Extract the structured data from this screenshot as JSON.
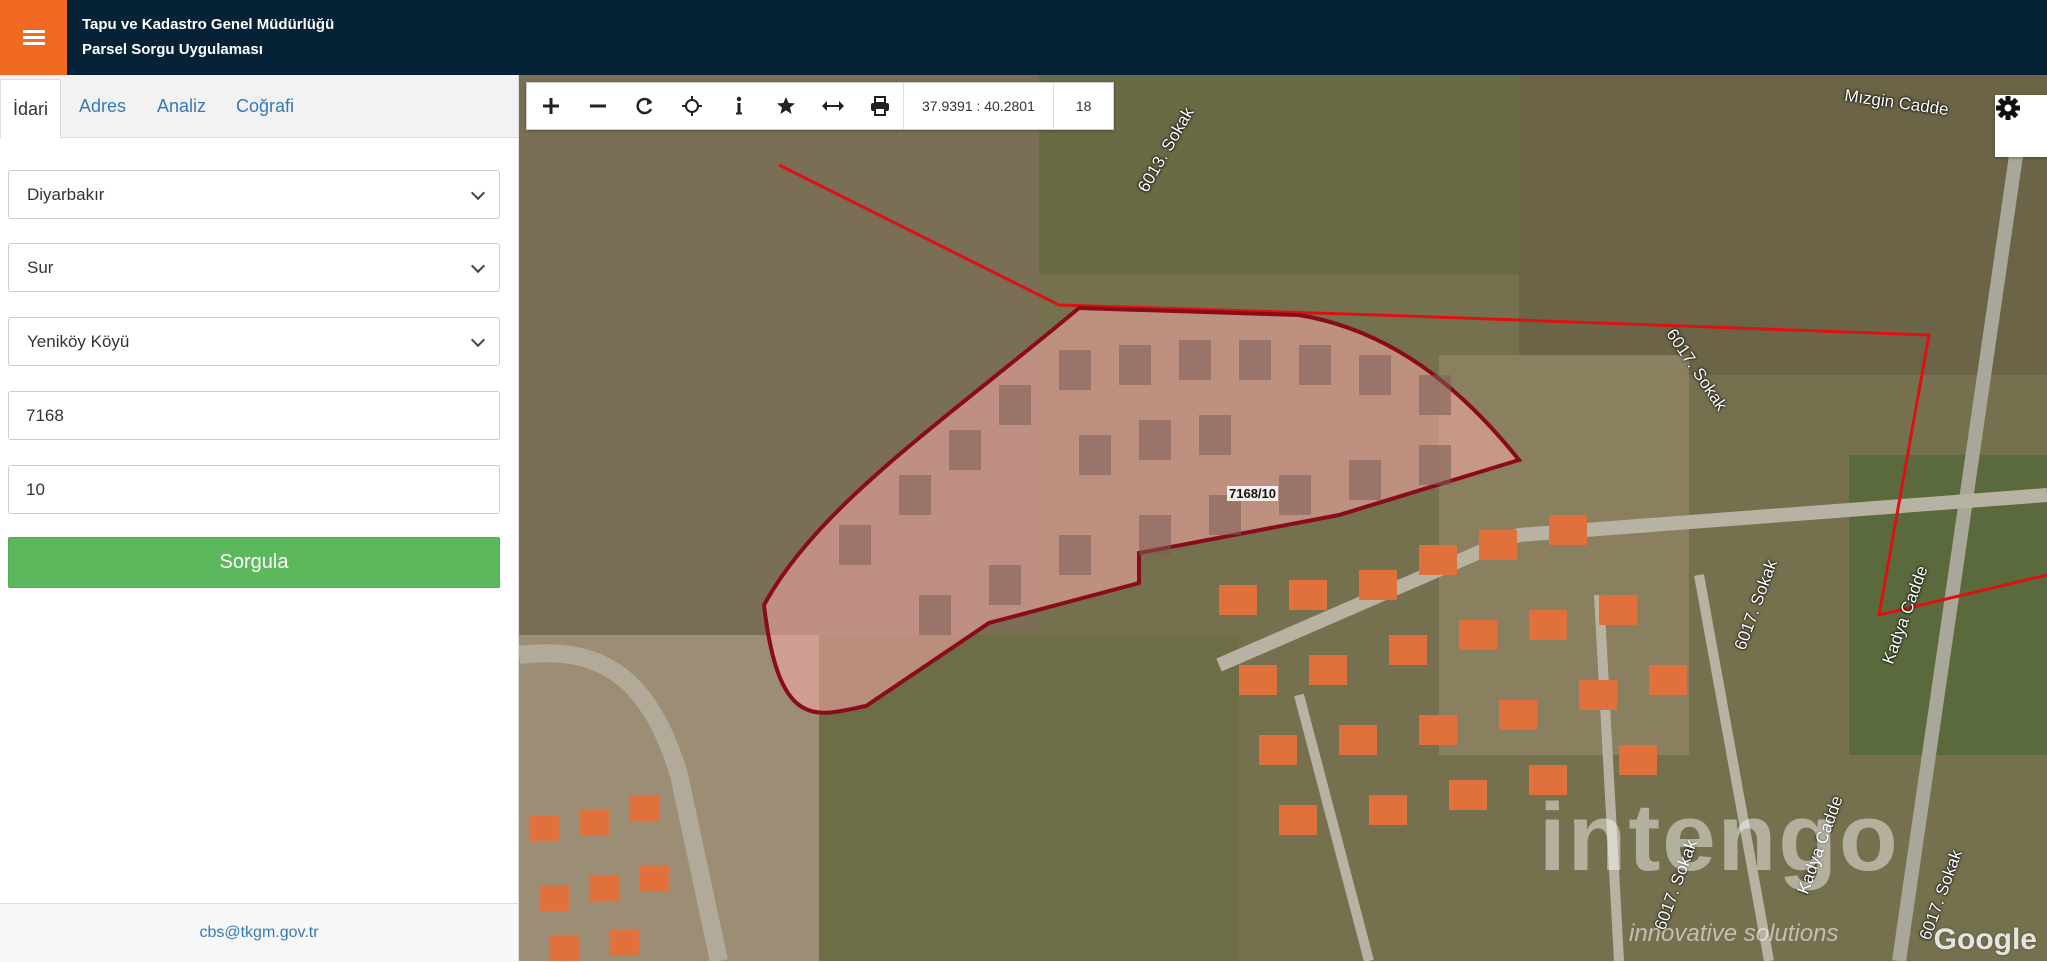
{
  "header": {
    "title_line1": "Tapu ve Kadastro Genel Müdürlüğü",
    "title_line2": "Parsel Sorgu Uygulaması",
    "menu_icon": "hamburger-icon",
    "accent_color": "#f26a21",
    "background_color": "#062236"
  },
  "tabs": [
    {
      "label": "İdari",
      "active": true
    },
    {
      "label": "Adres",
      "active": false
    },
    {
      "label": "Analiz",
      "active": false
    },
    {
      "label": "Coğrafi",
      "active": false
    }
  ],
  "form": {
    "province": "Diyarbakır",
    "district": "Sur",
    "neighborhood": "Yeniköy Köyü",
    "block": "7168",
    "parcel": "10",
    "submit_label": "Sorgula",
    "submit_color": "#5cb85c"
  },
  "footer": {
    "email": "cbs@tkgm.gov.tr"
  },
  "map": {
    "toolbar": {
      "tools": [
        "zoom-in-icon",
        "zoom-out-icon",
        "refresh-icon",
        "locate-icon",
        "info-icon",
        "star-icon",
        "measure-icon",
        "print-icon"
      ],
      "coordinates": "37.9391 : 40.2801",
      "zoom_level": "18"
    },
    "settings_icon": "gear-icon",
    "parcel_label": "7168/10",
    "street_labels": [
      "Mızgin Cadde",
      "6013. Sokak",
      "6017. Sokak",
      "6017. Sokak",
      "Kadya Cadde",
      "Kadya Cadde",
      "6017. Sokak",
      "6017. Sokak"
    ],
    "watermark": "intengo",
    "watermark_sub": "innovative solutions",
    "attribution": "Google",
    "parcel_color": "#a01020"
  }
}
